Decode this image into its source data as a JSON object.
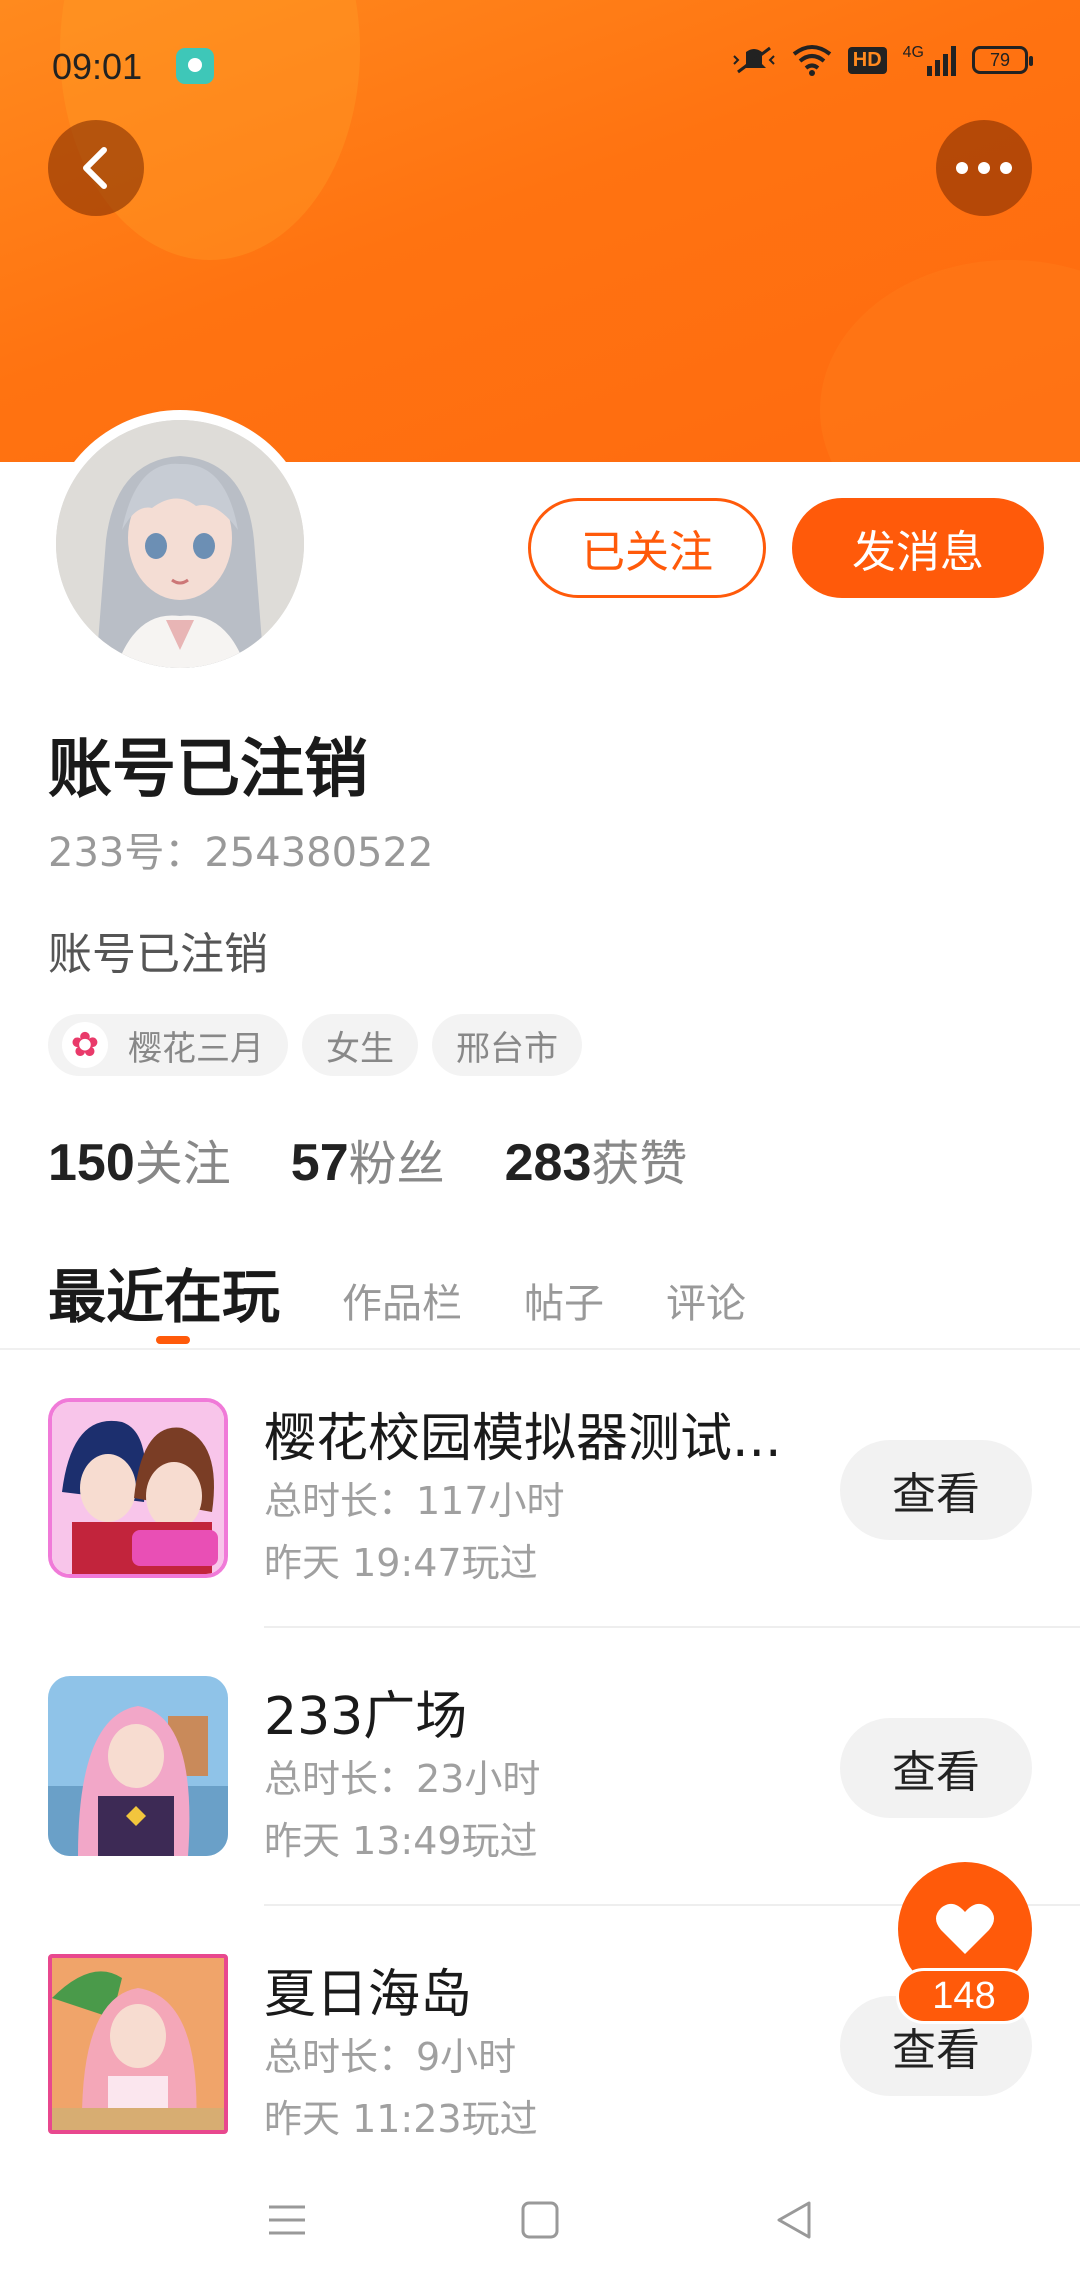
{
  "status_bar": {
    "time": "09:01",
    "network": "4G",
    "hd": "HD",
    "battery": "79"
  },
  "header": {
    "back_icon": "chevron-left-icon",
    "more_icon": "more-dots-icon"
  },
  "profile": {
    "name": "账号已注销",
    "id_text": "233号：254380522",
    "bio": "账号已注销",
    "follow_label": "已关注",
    "message_label": "发消息",
    "tags": [
      "樱花三月",
      "女生",
      "邢台市"
    ],
    "stats": [
      {
        "value": "150",
        "label": "关注"
      },
      {
        "value": "57",
        "label": "粉丝"
      },
      {
        "value": "283",
        "label": "获赞"
      }
    ]
  },
  "tabs": [
    "最近在玩",
    "作品栏",
    "帖子",
    "评论"
  ],
  "games": [
    {
      "title": "樱花校园模拟器测试...",
      "duration": "总时长：117小时",
      "last_played": "昨天 19:47玩过",
      "action": "查看"
    },
    {
      "title": "233广场",
      "duration": "总时长：23小时",
      "last_played": "昨天 13:49玩过",
      "action": "查看"
    },
    {
      "title": "夏日海岛",
      "duration": "总时长：9小时",
      "last_played": "昨天 11:23玩过",
      "action": "查看"
    }
  ],
  "like": {
    "count": "148",
    "icon": "heart-icon"
  },
  "colors": {
    "accent": "#ff5a0a",
    "banner": "#ff7311"
  }
}
